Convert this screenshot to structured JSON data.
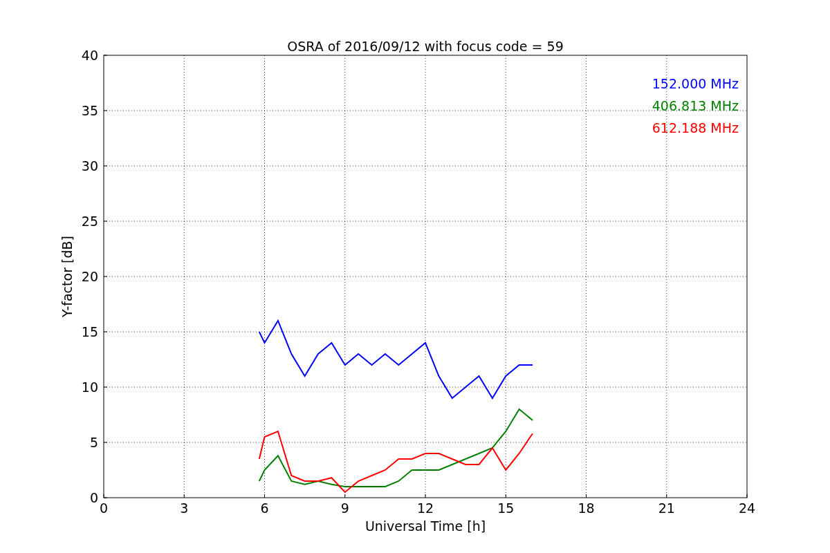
{
  "chart_data": {
    "type": "line",
    "title": "OSRA of 2016/09/12 with focus code = 59",
    "xlabel": "Universal Time [h]",
    "ylabel": "Y-factor [dB]",
    "x": [
      5.8,
      6,
      6.5,
      7,
      7.5,
      8,
      8.5,
      9,
      9.5,
      10,
      10.5,
      11,
      11.5,
      12,
      12.5,
      13,
      13.5,
      14,
      14.5,
      15,
      15.5,
      16
    ],
    "series": [
      {
        "name": "152.000 MHz",
        "color": "#0000ff",
        "values": [
          15,
          14,
          16,
          13,
          11,
          13,
          14,
          12,
          13,
          12,
          13,
          12,
          13,
          14,
          11,
          9,
          10,
          11,
          9,
          11,
          12,
          12
        ]
      },
      {
        "name": "406.813 MHz",
        "color": "#008000",
        "values": [
          1.5,
          2.5,
          3.8,
          1.5,
          1.2,
          1.5,
          1.2,
          1,
          1,
          1,
          1,
          1.5,
          2.5,
          2.5,
          2.5,
          3,
          3.5,
          4,
          4.5,
          6,
          8,
          7
        ]
      },
      {
        "name": "612.188 MHz",
        "color": "#ff0000",
        "values": [
          3.5,
          5.5,
          6,
          2,
          1.5,
          1.5,
          1.8,
          0.5,
          1.5,
          2,
          2.5,
          3.5,
          3.5,
          4,
          4,
          3.5,
          3,
          3,
          4.5,
          2.5,
          4,
          5.8
        ]
      }
    ],
    "xlim": [
      0,
      24
    ],
    "ylim": [
      0,
      40
    ],
    "xticks": [
      0,
      3,
      6,
      9,
      12,
      15,
      18,
      21,
      24
    ],
    "yticks": [
      0,
      5,
      10,
      15,
      20,
      25,
      30,
      35,
      40
    ],
    "grid": true
  }
}
